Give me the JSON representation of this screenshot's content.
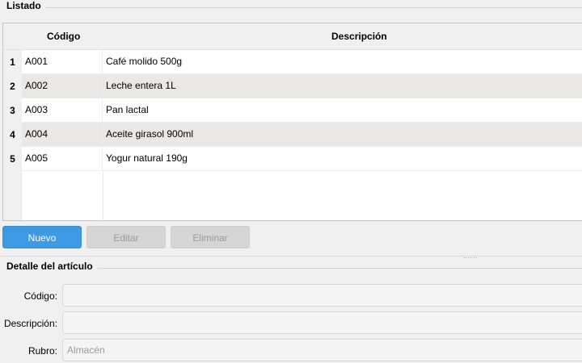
{
  "list_group": {
    "title": "Listado"
  },
  "table": {
    "columns": [
      "Código",
      "Descripción"
    ],
    "rows": [
      {
        "num": "1",
        "code": "A001",
        "desc": "Café molido 500g"
      },
      {
        "num": "2",
        "code": "A002",
        "desc": "Leche entera 1L"
      },
      {
        "num": "3",
        "code": "A003",
        "desc": "Pan lactal"
      },
      {
        "num": "4",
        "code": "A004",
        "desc": "Aceite girasol 900ml"
      },
      {
        "num": "5",
        "code": "A005",
        "desc": "Yogur natural 190g"
      }
    ]
  },
  "actions": {
    "new_label": "Nuevo",
    "edit_label": "Editar",
    "delete_label": "Eliminar"
  },
  "detail_group": {
    "title": "Detalle del artículo",
    "code_label": "Código:",
    "code_value": "",
    "desc_label": "Descripción:",
    "desc_value": "",
    "category_label": "Rubro:",
    "category_placeholder": "Almacén"
  },
  "colors": {
    "primary": "#3d9ae3",
    "row_alt": "#e9e8e4",
    "background": "#f0f0f0"
  }
}
